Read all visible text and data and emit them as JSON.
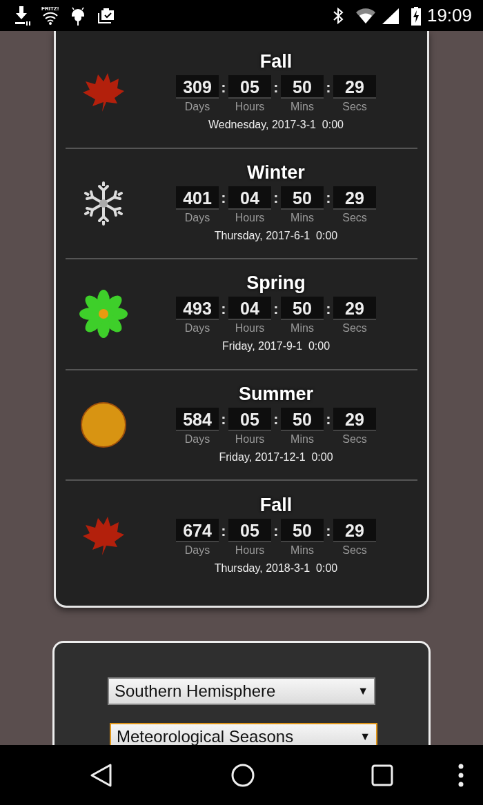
{
  "status_bar": {
    "wifi_label": "FRITZ!",
    "time": "19:09"
  },
  "seasons": [
    {
      "kind": "leaf",
      "name": "Fall",
      "counters": [
        {
          "value": "309",
          "unit": "Days"
        },
        {
          "separator": ":",
          "value": "05",
          "unit": "Hours"
        },
        {
          "separator": ":",
          "value": "50",
          "unit": "Mins"
        },
        {
          "separator": ":",
          "value": "29",
          "unit": "Secs"
        }
      ],
      "date": "Wednesday, 2017-3-1  0:00"
    },
    {
      "kind": "snowflake",
      "name": "Winter",
      "counters": [
        {
          "value": "401",
          "unit": "Days"
        },
        {
          "separator": ":",
          "value": "04",
          "unit": "Hours"
        },
        {
          "separator": ":",
          "value": "50",
          "unit": "Mins"
        },
        {
          "separator": ":",
          "value": "29",
          "unit": "Secs"
        }
      ],
      "date": "Thursday, 2017-6-1  0:00"
    },
    {
      "kind": "flower",
      "name": "Spring",
      "counters": [
        {
          "value": "493",
          "unit": "Days"
        },
        {
          "separator": ":",
          "value": "04",
          "unit": "Hours"
        },
        {
          "separator": ":",
          "value": "50",
          "unit": "Mins"
        },
        {
          "separator": ":",
          "value": "29",
          "unit": "Secs"
        }
      ],
      "date": "Friday, 2017-9-1  0:00"
    },
    {
      "kind": "sun",
      "name": "Summer",
      "counters": [
        {
          "value": "584",
          "unit": "Days"
        },
        {
          "separator": ":",
          "value": "05",
          "unit": "Hours"
        },
        {
          "separator": ":",
          "value": "50",
          "unit": "Mins"
        },
        {
          "separator": ":",
          "value": "29",
          "unit": "Secs"
        }
      ],
      "date": "Friday, 2017-12-1  0:00"
    },
    {
      "kind": "leaf",
      "name": "Fall",
      "counters": [
        {
          "value": "674",
          "unit": "Days"
        },
        {
          "separator": ":",
          "value": "05",
          "unit": "Hours"
        },
        {
          "separator": ":",
          "value": "50",
          "unit": "Mins"
        },
        {
          "separator": ":",
          "value": "29",
          "unit": "Secs"
        }
      ],
      "date": "Thursday, 2018-3-1  0:00"
    }
  ],
  "dropdowns": [
    {
      "value": "Southern Hemisphere",
      "arrow": "▼",
      "focused": false
    },
    {
      "value": "Meteorological Seasons",
      "arrow": "▼",
      "focused": true
    }
  ]
}
